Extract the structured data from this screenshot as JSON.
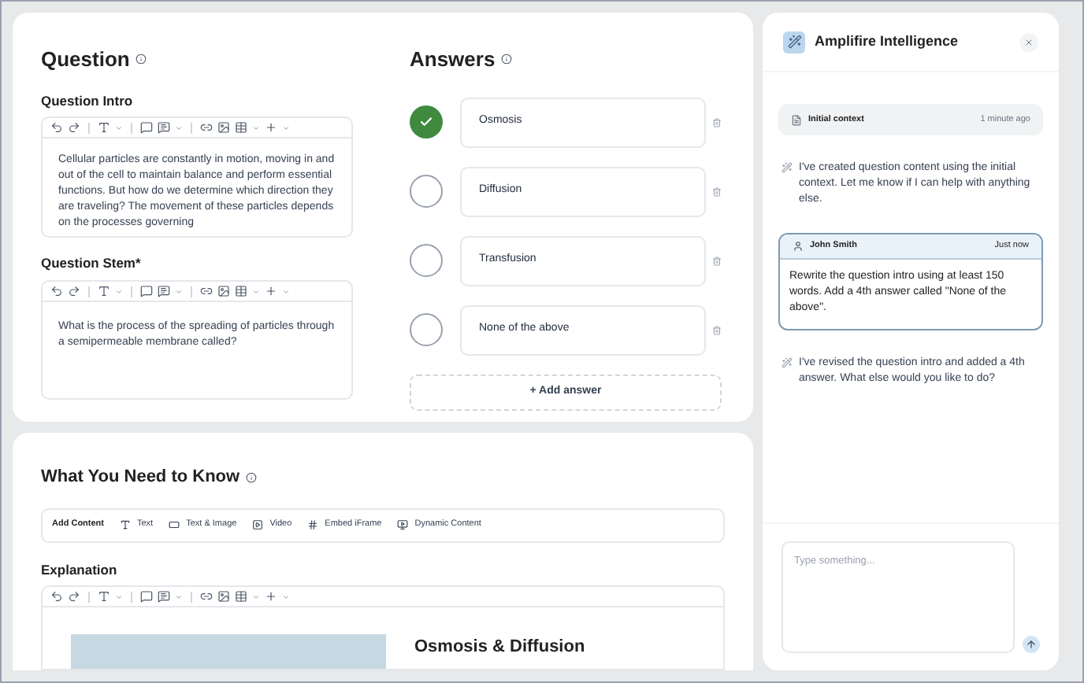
{
  "question": {
    "title": "Question",
    "intro": {
      "label": "Question Intro",
      "text": "Cellular particles are constantly in motion, moving in and out of the cell to maintain balance and perform essential functions. But how do we determine which direction they are traveling? The movement of these particles depends on the processes governing"
    },
    "stem": {
      "label": "Question Stem*",
      "text": "What is the process of the spreading of particles through a semipermeable membrane called?"
    }
  },
  "answers": {
    "title": "Answers",
    "items": [
      {
        "text": "Osmosis",
        "selected": true
      },
      {
        "text": "Diffusion",
        "selected": false
      },
      {
        "text": "Transfusion",
        "selected": false
      },
      {
        "text": "None of the above",
        "selected": false
      }
    ],
    "add_label": "+ Add answer"
  },
  "know": {
    "title": "What You Need to Know",
    "add_content": {
      "label": "Add Content",
      "items": [
        {
          "kind": "text",
          "label": "Text"
        },
        {
          "kind": "text_image",
          "label": "Text & Image"
        },
        {
          "kind": "video",
          "label": "Video"
        },
        {
          "kind": "embed",
          "label": "Embed iFrame"
        },
        {
          "kind": "dynamic",
          "label": "Dynamic Content"
        }
      ]
    },
    "explanation": {
      "label": "Explanation",
      "heading": "Osmosis & Diffusion"
    }
  },
  "assistant": {
    "title": "Amplifire Intelligence",
    "context": {
      "label": "Initial context",
      "time": "1 minute ago"
    },
    "messages": [
      {
        "kind": "assistant",
        "text": "I've created question content using the initial context. Let me know if I can help with anything else."
      },
      {
        "kind": "user",
        "author": "John Smith",
        "time": "Just now",
        "text": "Rewrite the question intro using at least 150 words. Add a 4th answer called \"None of the above\"."
      },
      {
        "kind": "assistant",
        "text": "I've revised the question intro and added a 4th answer. What else would you like to do?"
      }
    ],
    "input": {
      "placeholder": "Type something..."
    }
  }
}
